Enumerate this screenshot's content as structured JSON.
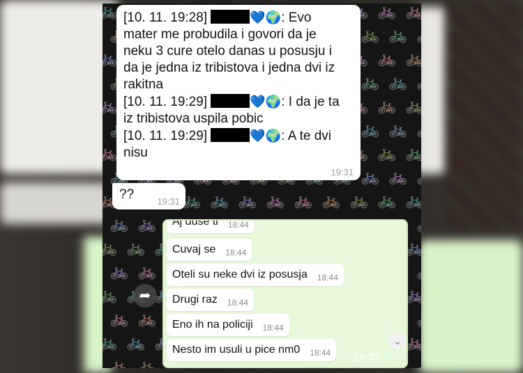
{
  "chat": {
    "top_bubble": {
      "lines": [
        "[10. 11. 19:28]",
        ": Evo",
        "mater me probudila i govori da je",
        "neku 3 cure otelo danas u posusju i",
        "da je jedna iz tribistova i jedna dvi iz",
        "rakitna",
        "[10. 11. 19:29]",
        ": I da je ta",
        "iz tribistova uspila pobic",
        "[10. 11. 19:29]",
        ": A te dvi",
        "nisu"
      ],
      "emoji_heart": "💙",
      "emoji_globe": "🌍",
      "time": "19:31"
    },
    "question_bubble": {
      "text": "??",
      "time": "19:31"
    },
    "forwarded_screenshot": {
      "messages": [
        {
          "text": "Aj duse ti",
          "time": "18:44"
        },
        {
          "text": "Cuvaj se",
          "time": "18:44"
        },
        {
          "text": "Oteli su neke dvi iz posusja",
          "time": "18:44"
        },
        {
          "text": "Drugi raz",
          "time": "18:44"
        },
        {
          "text": "Eno ih na policiji",
          "time": "18:44"
        },
        {
          "text": "Nesto im usuli u pice nm0",
          "time": "18:44"
        }
      ],
      "time": "19:35",
      "ticks": "✓✓"
    },
    "icons": {
      "forward": "forward-arrow-icon",
      "scroll": "chevron-down-icon"
    },
    "colors": {
      "outgoing_bubble": "#dcf8c6",
      "incoming_bubble": "#ffffff"
    }
  }
}
